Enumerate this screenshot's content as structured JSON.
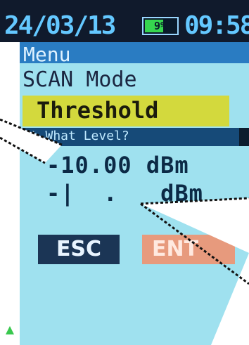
{
  "status_bar": {
    "date": "24/03/13",
    "battery_percent": "9%",
    "battery_level": 0.09,
    "time": "09:58"
  },
  "menu": {
    "title": "Menu",
    "mode_label": "SCAN Mode",
    "selected_item": "Threshold"
  },
  "dialog": {
    "prompt": "At What Level?",
    "current_value": "-10.00 dBm",
    "input_value": "-|  .   dBm"
  },
  "buttons": {
    "esc_label": "ESC",
    "enter_label": "ENT"
  },
  "colors": {
    "status_bg": "#101a2c",
    "menu_header": "#2a7cc2",
    "dialog_bg": "#9fe1ef",
    "highlight": "#d3d93d",
    "esc_button": "#1b3555",
    "enter_button": "#e79a7d",
    "battery": "#36d64f"
  },
  "icons": {
    "battery": "battery-icon",
    "scroll_indicator": "up-arrow-icon"
  }
}
